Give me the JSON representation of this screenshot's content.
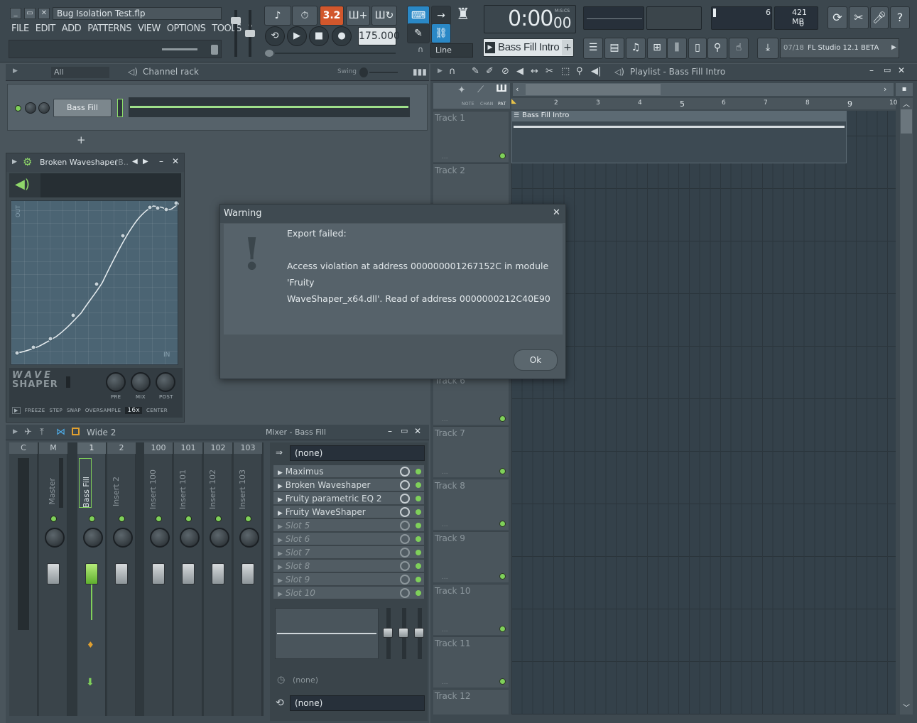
{
  "window": {
    "title": "Bug Isolation Test.flp",
    "menu": [
      "FILE",
      "EDIT",
      "ADD",
      "PATTERNS",
      "VIEW",
      "OPTIONS",
      "TOOLS",
      "?"
    ]
  },
  "transport": {
    "tempo": "175.000",
    "time": "0:00",
    "time_sub": "00",
    "time_unit": "M:S:CS",
    "snap_mode": "Line",
    "pattern_name": "Bass Fill Intro",
    "cpu_value": "6",
    "memory": "421 MB",
    "poly_value": "0",
    "news_date": "07/18",
    "news_text": "FL Studio 12.1 BETA",
    "pattern_badge": "3.2"
  },
  "channel_rack": {
    "filter": "All",
    "title": "Channel rack",
    "swing_label": "Swing",
    "channel_name": "Bass Fill",
    "add_label": "+"
  },
  "waveshaper": {
    "title": "Broken Waveshaper",
    "title_suffix": "(B..",
    "logo_top": "WAVE",
    "logo_bottom": "SHAPER",
    "out_label": "OUT",
    "in_label": "IN",
    "knob_labels": [
      "PRE",
      "MIX",
      "POST"
    ],
    "bottom_options": [
      "FREEZE",
      "STEP",
      "SNAP",
      "OVERSAMPLE",
      "16x",
      "CENTER"
    ]
  },
  "mixer": {
    "view_mode": "Wide 2",
    "title": "Mixer - Bass Fill",
    "input": "(none)",
    "output": "(none)",
    "bottom_none": "(none)",
    "strips": [
      {
        "num": "C",
        "label": ""
      },
      {
        "num": "M",
        "label": "Master"
      },
      {
        "num": "1",
        "label": "Bass Fill"
      },
      {
        "num": "2",
        "label": "Insert 2"
      },
      {
        "num": "100",
        "label": "Insert 100"
      },
      {
        "num": "101",
        "label": "Insert 101"
      },
      {
        "num": "102",
        "label": "Insert 102"
      },
      {
        "num": "103",
        "label": "Insert 103"
      }
    ],
    "slots": [
      "Maximus",
      "Broken Waveshaper",
      "Fruity parametric EQ 2",
      "Fruity WaveShaper",
      "Slot 5",
      "Slot 6",
      "Slot 7",
      "Slot 8",
      "Slot 9",
      "Slot 10"
    ]
  },
  "playlist": {
    "title": "Playlist - Bass Fill Intro",
    "header_labels": [
      "NOTE",
      "CHAN",
      "PAT"
    ],
    "bar_numbers": [
      "2",
      "3",
      "4",
      "5",
      "6",
      "7",
      "8",
      "9",
      "10"
    ],
    "clip_name": "Bass Fill Intro",
    "tracks": [
      "Track 1",
      "Track 2",
      "Track 6",
      "Track 7",
      "Track 8",
      "Track 9",
      "Track 10",
      "Track 11",
      "Track 12"
    ]
  },
  "dialog": {
    "title": "Warning",
    "line1": "Export failed:",
    "line2": "Access violation at address 000000001267152C in module 'Fruity",
    "line3": "WaveShaper_x64.dll'. Read of address 0000000212C40E90",
    "ok": "Ok"
  },
  "colors": {
    "accent_blue": "#2a88c6",
    "accent_orange": "#d2572c",
    "led_green": "#7fd05a"
  }
}
